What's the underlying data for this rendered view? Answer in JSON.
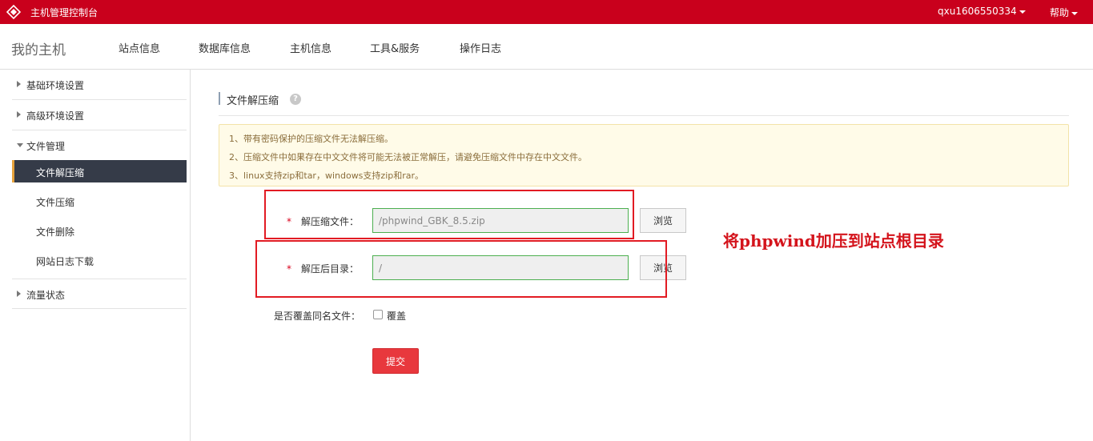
{
  "topbar": {
    "logo_icon": "diamond-logo-icon",
    "app_title": "主机管理控制台",
    "user": "qxu1606550334",
    "help": "帮助",
    "bg_color": "#c9001c"
  },
  "navbar": {
    "brand": "我的主机",
    "items": [
      {
        "label": "站点信息"
      },
      {
        "label": "数据库信息"
      },
      {
        "label": "主机信息"
      },
      {
        "label": "工具&服务"
      },
      {
        "label": "操作日志"
      }
    ]
  },
  "sidebar": {
    "groups": [
      {
        "label": "基础环境设置",
        "expanded": false
      },
      {
        "label": "高级环境设置",
        "expanded": false
      },
      {
        "label": "文件管理",
        "expanded": true
      },
      {
        "label": "流量状态",
        "expanded": false
      }
    ],
    "file_items": [
      {
        "label": "文件解压缩",
        "active": true
      },
      {
        "label": "文件压缩",
        "active": false
      },
      {
        "label": "文件删除",
        "active": false
      },
      {
        "label": "网站日志下载",
        "active": false
      }
    ],
    "active_color": "#353b48"
  },
  "main": {
    "section_title": "文件解压缩",
    "help_glyph": "?",
    "notices": [
      "1、带有密码保护的压缩文件无法解压缩。",
      "2、压缩文件中如果存在中文文件将可能无法被正常解压，请避免压缩文件中存在中文文件。",
      "3、linux支持zip和tar，windows支持zip和rar。"
    ],
    "form": {
      "required_mark": "*",
      "archive_label": "解压缩文件：",
      "archive_value": "/phpwind_GBK_8.5.zip",
      "target_label": "解压后目录：",
      "target_value": "/",
      "browse_label": "浏览",
      "overwrite_label": "是否覆盖同名文件：",
      "overwrite_option": "覆盖",
      "overwrite_checked": false,
      "submit_label": "提交"
    }
  },
  "annotation": {
    "text": "将phpwind加压到站点根目录",
    "color": "#e21b23"
  }
}
